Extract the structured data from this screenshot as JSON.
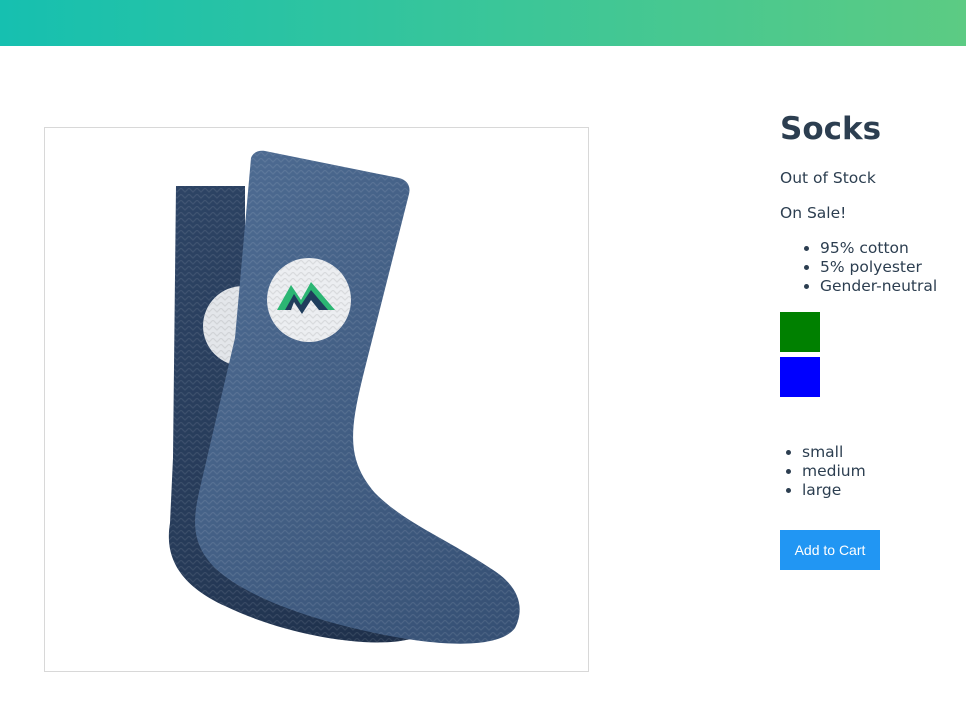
{
  "nav": {
    "gradient_start": "#16c0b0",
    "gradient_end": "#5ccb83"
  },
  "product": {
    "image_alt": "blue socks",
    "title": "Socks",
    "stock_status": "Out of Stock",
    "sale_label": "On Sale!",
    "details": [
      "95% cotton",
      "5% polyester",
      "Gender-neutral"
    ],
    "variants": [
      {
        "color_name": "green",
        "swatch_color": "#008000"
      },
      {
        "color_name": "blue",
        "swatch_color": "#0000ff"
      }
    ],
    "sizes": [
      "small",
      "medium",
      "large"
    ],
    "add_to_cart_label": "Add to Cart",
    "button_color": "#2196f3"
  }
}
